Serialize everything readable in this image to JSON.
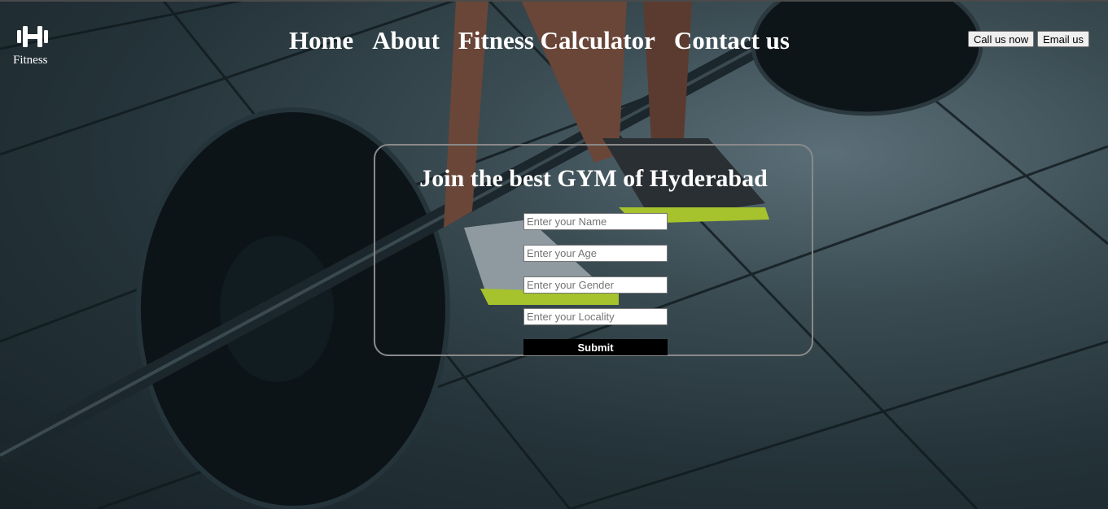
{
  "logo": {
    "icon": "dumbbell-icon",
    "label": "Fitness"
  },
  "nav": {
    "items": [
      {
        "label": "Home"
      },
      {
        "label": "About"
      },
      {
        "label": "Fitness Calculator"
      },
      {
        "label": "Contact us"
      }
    ]
  },
  "header_actions": {
    "call_label": "Call us now",
    "email_label": "Email us"
  },
  "form": {
    "title": "Join the best GYM of Hyderabad",
    "name_placeholder": "Enter your Name",
    "age_placeholder": "Enter your Age",
    "gender_placeholder": "Enter your Gender",
    "locality_placeholder": "Enter your Locality",
    "submit_label": "Submit"
  },
  "colors": {
    "text": "#ffffff",
    "submit_bg": "#000000",
    "card_border": "#8a8a8a"
  }
}
